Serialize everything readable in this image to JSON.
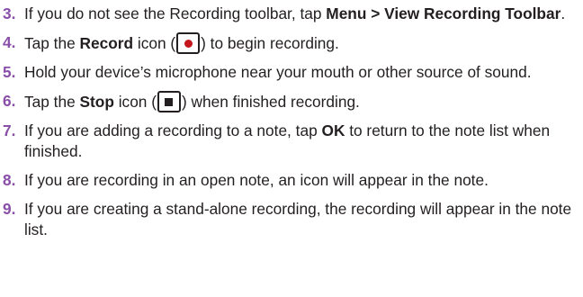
{
  "steps": [
    {
      "number": "3.",
      "text_before": "If you do not see the Recording toolbar, tap ",
      "bold": "Menu > View Recording Toolbar",
      "text_after": "."
    },
    {
      "number": "4.",
      "text_before": "Tap the ",
      "bold": "Record",
      "text_mid": " icon (",
      "icon": "record-icon",
      "text_after": ") to begin recording."
    },
    {
      "number": "5.",
      "text": "Hold your device’s microphone near your mouth or other source of sound."
    },
    {
      "number": "6.",
      "text_before": "Tap the ",
      "bold": "Stop",
      "text_mid": " icon (",
      "icon": "stop-icon",
      "text_after": ") when finished recording."
    },
    {
      "number": "7.",
      "text_before": "If you are adding a recording to a note, tap ",
      "bold": "OK",
      "text_after": " to return to the note list when finished."
    },
    {
      "number": "8.",
      "text": "If you are recording in an open note, an icon will appear in the note."
    },
    {
      "number": "9.",
      "text": "If you are creating a stand-alone recording, the recording will appear in the note list."
    }
  ],
  "colors": {
    "step_number": "#8a4fa8",
    "record_dot": "#c4161c",
    "text": "#231f20"
  }
}
